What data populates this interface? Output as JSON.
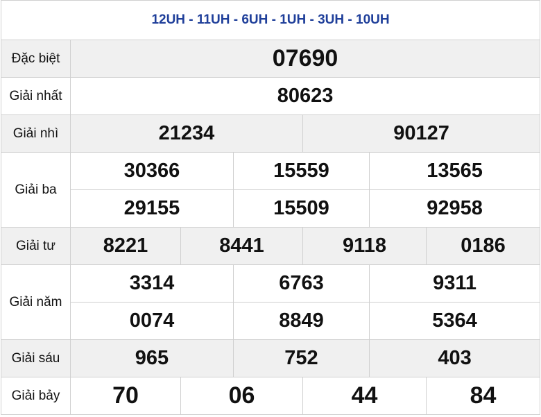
{
  "header": {
    "codes": "12UH - 11UH - 6UH - 1UH - 3UH - 10UH"
  },
  "colors": {
    "accent_red": "#e02424",
    "header_blue": "#1f3f9a",
    "row_gray": "#f0f0f0"
  },
  "prizes": {
    "special": {
      "label": "Đặc biệt",
      "numbers": [
        "07690"
      ]
    },
    "first": {
      "label": "Giải nhất",
      "numbers": [
        "80623"
      ]
    },
    "second": {
      "label": "Giải nhì",
      "numbers": [
        "21234",
        "90127"
      ]
    },
    "third": {
      "label": "Giải ba",
      "numbers": [
        "30366",
        "15559",
        "13565",
        "29155",
        "15509",
        "92958"
      ]
    },
    "fourth": {
      "label": "Giải tư",
      "numbers": [
        "8221",
        "8441",
        "9118",
        "0186"
      ]
    },
    "fifth": {
      "label": "Giải năm",
      "numbers": [
        "3314",
        "6763",
        "9311",
        "0074",
        "8849",
        "5364"
      ]
    },
    "sixth": {
      "label": "Giải sáu",
      "numbers": [
        "965",
        "752",
        "403"
      ]
    },
    "seventh": {
      "label": "Giải bảy",
      "numbers": [
        "70",
        "06",
        "44",
        "84"
      ]
    }
  }
}
